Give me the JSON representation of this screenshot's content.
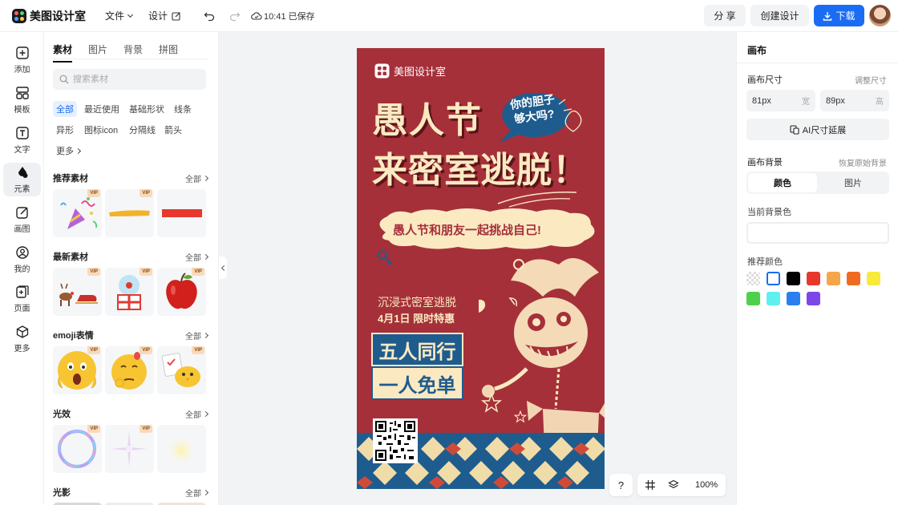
{
  "app": {
    "name": "美图设计室"
  },
  "header": {
    "file_menu": "文件",
    "design_menu": "设计",
    "save_status": "10:41 已保存",
    "share_label": "分 享",
    "create_label": "创建设计",
    "download_label": "下载"
  },
  "rail": {
    "items": [
      {
        "label": "添加"
      },
      {
        "label": "模板"
      },
      {
        "label": "文字"
      },
      {
        "label": "元素"
      },
      {
        "label": "画图"
      },
      {
        "label": "我的"
      },
      {
        "label": "页面"
      },
      {
        "label": "更多"
      }
    ]
  },
  "panel": {
    "tabs": [
      "素材",
      "图片",
      "背景",
      "拼图"
    ],
    "search_placeholder": "搜索素材",
    "chips": [
      "全部",
      "最近使用",
      "基础形状",
      "线条",
      "异形",
      "图标icon",
      "分隔线",
      "箭头",
      "更多"
    ],
    "all_label": "全部",
    "vip_label": "VIP",
    "sections": [
      "推荐素材",
      "最新素材",
      "emoji表情",
      "光效",
      "光影"
    ]
  },
  "poster": {
    "brand": "美图设计室",
    "title_line1": "愚人节",
    "title_line2": "来密室逃脱！",
    "bubble_line1": "你的胆子",
    "bubble_line2": "够大吗?",
    "cloud_text": "愚人节和朋友一起挑战自己!",
    "sub1": "沉浸式密室逃脱",
    "sub2": "4月1日 限时特惠",
    "promo1": "五人同行",
    "promo2": "一人免单"
  },
  "canvas_tools": {
    "help": "?",
    "zoom": "100%"
  },
  "right_panel": {
    "title": "画布",
    "size_label": "画布尺寸",
    "adjust_size": "调整尺寸",
    "width_value": "81px",
    "width_unit": "宽",
    "height_value": "89px",
    "height_unit": "高",
    "ai_extend": "AI尺寸延展",
    "bg_label": "画布背景",
    "restore_bg": "恢复原始背景",
    "bg_tab_color": "颜色",
    "bg_tab_image": "图片",
    "current_bg": "当前背景色",
    "recommended": "推荐颜色",
    "swatches": [
      "transparent",
      "#ffffff",
      "#000000",
      "#e8382c",
      "#f5a54a",
      "#f06a1f",
      "#f8ea3b",
      "#4ed14a",
      "#5ef0ee",
      "#2a7ff0",
      "#7b47e8"
    ]
  },
  "colors": {
    "accent": "#1a6cf5",
    "poster_bg": "#a5303a",
    "poster_cream": "#fbe9c2",
    "poster_blue": "#1f5c8e"
  }
}
